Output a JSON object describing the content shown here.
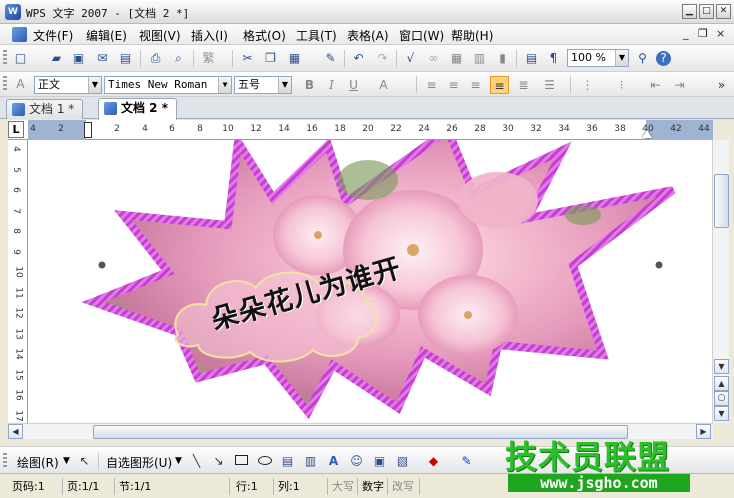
{
  "window": {
    "title": "WPS 文字 2007 - [文档 2 *]",
    "app_icon_letter": "W",
    "controls": {
      "minimize": "▁",
      "maximize": "□",
      "close": "✕"
    }
  },
  "menubar": {
    "items": [
      {
        "label": "文件(F)"
      },
      {
        "label": "编辑(E)"
      },
      {
        "label": "视图(V)"
      },
      {
        "label": "插入(I)"
      },
      {
        "label": "格式(O)"
      },
      {
        "label": "工具(T)"
      },
      {
        "label": "表格(A)"
      },
      {
        "label": "窗口(W)"
      },
      {
        "label": "帮助(H)"
      }
    ],
    "mdi": {
      "minimize": "_",
      "restore": "❐",
      "close": "×"
    }
  },
  "standard_toolbar": {
    "zoom": "100 %",
    "buttons": [
      {
        "name": "new-document-icon",
        "glyph": "□"
      },
      {
        "name": "open-folder-icon",
        "glyph": "▰"
      },
      {
        "name": "save-icon",
        "glyph": "▣"
      },
      {
        "name": "mail-icon",
        "glyph": "✉"
      },
      {
        "name": "export-pdf-icon",
        "glyph": "▤"
      },
      {
        "name": "print-icon",
        "glyph": "⎙"
      },
      {
        "name": "print-preview-icon",
        "glyph": "⌕"
      },
      {
        "name": "simplified-traditional-icon",
        "glyph": "繁"
      },
      {
        "name": "cut-icon",
        "glyph": "✂"
      },
      {
        "name": "copy-icon",
        "glyph": "❐"
      },
      {
        "name": "paste-icon",
        "glyph": "▦"
      },
      {
        "name": "format-painter-icon",
        "glyph": "✎"
      },
      {
        "name": "undo-icon",
        "glyph": "↶"
      },
      {
        "name": "redo-icon",
        "glyph": "↷"
      },
      {
        "name": "equation-icon",
        "glyph": "√"
      },
      {
        "name": "hyperlink-icon",
        "glyph": "∞"
      },
      {
        "name": "table-icon",
        "glyph": "▦"
      },
      {
        "name": "columns-icon",
        "glyph": "▥"
      },
      {
        "name": "chart-icon",
        "glyph": "▮"
      },
      {
        "name": "document-map-icon",
        "glyph": "▤"
      },
      {
        "name": "show-hide-icon",
        "glyph": "¶"
      },
      {
        "name": "find-icon",
        "glyph": "⚲"
      },
      {
        "name": "help-icon",
        "glyph": "?"
      }
    ]
  },
  "format_toolbar": {
    "style": "正文",
    "font": "Times New Roman",
    "size": "五号",
    "bold": "B",
    "italic": "I",
    "underline": "U",
    "font_color": "A"
  },
  "tabs": [
    {
      "label": "文档 1 *",
      "active": false
    },
    {
      "label": "文档 2 *",
      "active": true
    }
  ],
  "ruler": {
    "corner": "L",
    "h_ticks": [
      "4",
      "2",
      "2",
      "4",
      "6",
      "8",
      "10",
      "12",
      "14",
      "16",
      "18",
      "20",
      "22",
      "24",
      "26",
      "28",
      "30",
      "32",
      "34",
      "36",
      "38",
      "40",
      "42",
      "44"
    ],
    "v_ticks": [
      "4",
      "5",
      "6",
      "7",
      "8",
      "9",
      "10",
      "11",
      "12",
      "13",
      "14",
      "15",
      "16",
      "17"
    ]
  },
  "document": {
    "wordart_text": "朵朵花儿为谁开",
    "star_outline_color": "#cc3fd6",
    "star_fill_colors": [
      "#f4bcd0",
      "#e88bb0",
      "#7a8f5a"
    ],
    "cloud_outline_color": "#f1e3a0"
  },
  "drawing_toolbar": {
    "draw_label": "绘图(R)",
    "autoshape_label": "自选图形(U)"
  },
  "statusbar": {
    "page": "页码:1",
    "page_of": "页:1/1",
    "section": "节:1/1",
    "line": "行:1",
    "column": "列:1",
    "caps": "大写",
    "num": "数字",
    "overwrite": "改写"
  },
  "watermark": {
    "text": "技术员联盟",
    "url": "www.jsgho.com",
    "color": "#2bbf2b"
  }
}
